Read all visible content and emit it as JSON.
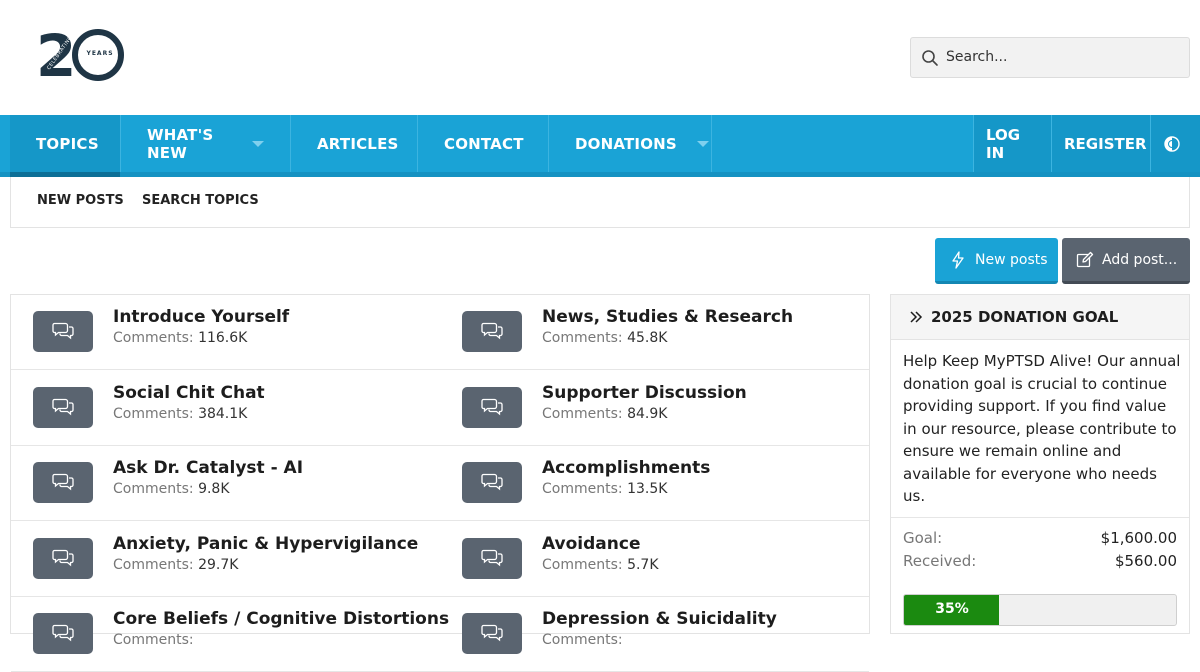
{
  "header": {
    "logo_number": "20",
    "logo_ring_text": "YEARS",
    "logo_arc_text": "CELEBRATING",
    "search_placeholder": "Search..."
  },
  "nav": {
    "items": [
      {
        "label": "TOPICS"
      },
      {
        "label": "WHAT'S NEW"
      },
      {
        "label": "ARTICLES"
      },
      {
        "label": "CONTACT"
      },
      {
        "label": "DONATIONS"
      }
    ],
    "login": "LOG IN",
    "register": "REGISTER"
  },
  "subnav": {
    "new_posts": "NEW POSTS",
    "search_topics": "SEARCH TOPICS"
  },
  "actions": {
    "new_posts": "New posts",
    "add_post": "Add post..."
  },
  "forums": [
    [
      {
        "title": "Introduce Yourself",
        "comments": "116.6K"
      },
      {
        "title": "News, Studies & Research",
        "comments": "45.8K"
      }
    ],
    [
      {
        "title": "Social Chit Chat",
        "comments": "384.1K"
      },
      {
        "title": "Supporter Discussion",
        "comments": "84.9K"
      }
    ],
    [
      {
        "title": "Ask Dr. Catalyst - AI",
        "comments": "9.8K"
      },
      {
        "title": "Accomplishments",
        "comments": "13.5K"
      }
    ],
    [
      {
        "title": "Anxiety, Panic & Hypervigilance",
        "comments": "29.7K"
      },
      {
        "title": "Avoidance",
        "comments": "5.7K"
      }
    ],
    [
      {
        "title": "Core Beliefs / Cognitive Distortions",
        "comments": ""
      },
      {
        "title": "Depression & Suicidality",
        "comments": ""
      }
    ]
  ],
  "comments_label": "Comments:",
  "donation": {
    "title": "2025 DONATION GOAL",
    "description": "Help Keep MyPTSD Alive! Our annual donation goal is crucial to continue providing support. If you find value in our resource, please contribute to ensure we remain online and available for everyone who needs us.",
    "goal_label": "Goal:",
    "goal_value": "$1,600.00",
    "received_label": "Received:",
    "received_value": "$560.00",
    "progress_text": "35%",
    "progress_fraction": 0.35
  },
  "colors": {
    "nav": "#1aa3d6",
    "button_gray": "#5a6470",
    "progress": "#1b8a10"
  }
}
